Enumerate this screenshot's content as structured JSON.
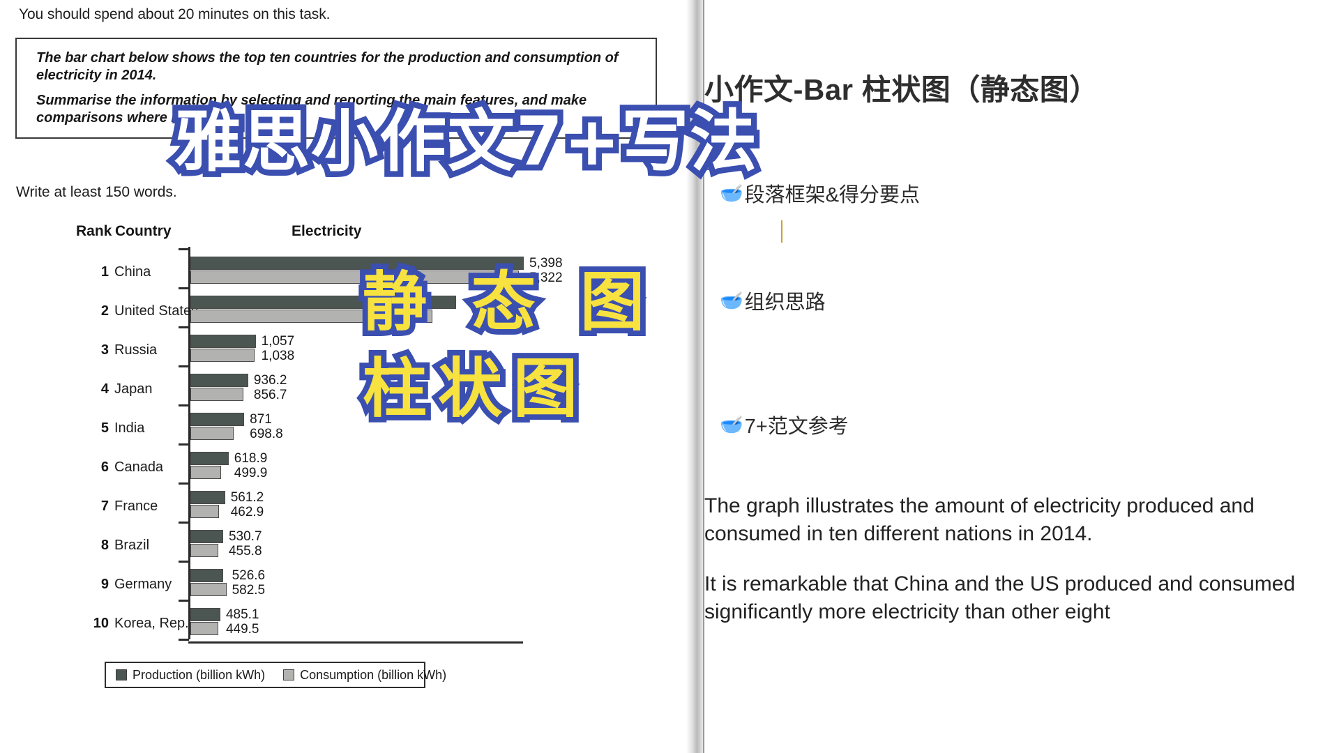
{
  "left_page": {
    "instruction": "You should spend about 20 minutes on this task.",
    "prompt_paragraph_1": "The bar chart below shows the top ten countries for the production and consumption of electricity in 2014.",
    "prompt_paragraph_2": "Summarise the information by selecting and reporting the main features, and make comparisons where relevant.",
    "word_count_note": "Write at least 150 words."
  },
  "chart_data": {
    "type": "bar",
    "orientation": "horizontal",
    "title": "Electricity",
    "column_headers": {
      "rank": "Rank",
      "country": "Country",
      "value": "Electricity"
    },
    "categories": [
      "China",
      "United States",
      "Russia",
      "Japan",
      "India",
      "Canada",
      "France",
      "Brazil",
      "Germany",
      "Korea, Rep."
    ],
    "ranks": [
      "1",
      "2",
      "3",
      "4",
      "5",
      "6",
      "7",
      "8",
      "9",
      "10"
    ],
    "series": [
      {
        "name": "Production (billion kWh)",
        "color": "#4b5551",
        "values": [
          5398,
          4298,
          1057,
          936.2,
          871,
          618.9,
          561.2,
          530.7,
          526.6,
          485.1
        ],
        "labels": [
          "5,398",
          "",
          "1,057",
          "936.2",
          "871",
          "618.9",
          "561.2",
          "530.7",
          "526.6",
          "485.1"
        ]
      },
      {
        "name": "Consumption (billion kWh)",
        "color": "#b2b3b1",
        "values": [
          5322,
          3913,
          1038,
          856.7,
          698.8,
          499.9,
          462.9,
          455.8,
          582.5,
          449.5
        ],
        "labels": [
          "5,322",
          "",
          "1,038",
          "856.7",
          "698.8",
          "499.9",
          "462.9",
          "455.8",
          "582.5",
          "449.5"
        ]
      }
    ],
    "legend": [
      {
        "label": "Production (billion kWh)",
        "color": "#4b5551"
      },
      {
        "label": "Consumption (billion kWh)",
        "color": "#b2b3b1"
      }
    ],
    "legend_position": "bottom",
    "grid": false,
    "xlabel": "",
    "ylabel": "",
    "unit": "billion kWh",
    "year": 2014
  },
  "right_page": {
    "title": "小作文-Bar 柱状图（静态图）",
    "bullets": [
      {
        "icon": "🥣",
        "text": "段落框架&得分要点"
      },
      {
        "icon": "🥣",
        "text": "组织思路"
      },
      {
        "icon": "🥣",
        "text": "7+范文参考"
      }
    ],
    "paragraph_1": "The graph illustrates the amount of electricity produced and consumed in ten different nations in 2014.",
    "paragraph_2": "It is remarkable that China and the US produced and consumed significantly more electricity than other eight"
  },
  "overlay": {
    "headline": "雅思小作文7+写法",
    "word_static": "静 态 图",
    "word_bar": "柱状图",
    "stroke_color": "#3b4fb0",
    "fill_white": "#ffffff",
    "fill_yellow": "#f7e23f"
  }
}
